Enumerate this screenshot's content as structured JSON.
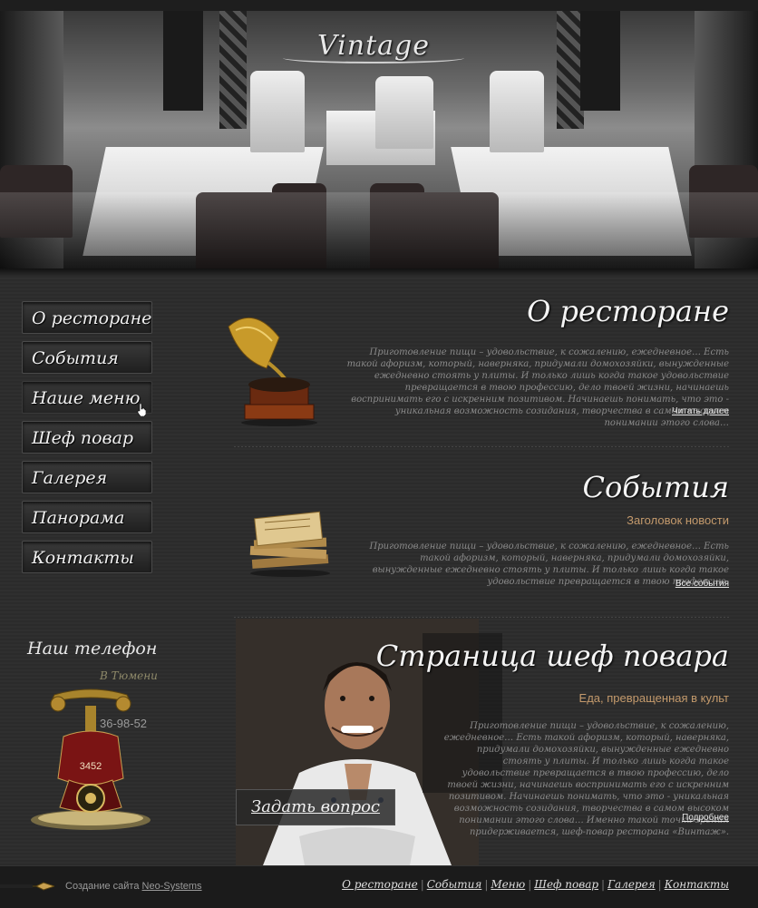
{
  "header": {
    "logo": "Vintage"
  },
  "nav": [
    {
      "label": "О ресторане",
      "id": "about"
    },
    {
      "label": "События",
      "id": "events"
    },
    {
      "label": "Наше меню",
      "id": "menu"
    },
    {
      "label": "Шеф повар",
      "id": "chef"
    },
    {
      "label": "Галерея",
      "id": "gallery"
    },
    {
      "label": "Панорама",
      "id": "panorama"
    },
    {
      "label": "Контакты",
      "id": "contacts"
    }
  ],
  "phone": {
    "title": "Наш телефон",
    "city": "В Тюмени",
    "number_prefix": "3452",
    "number": "36-98-52"
  },
  "about": {
    "title": "О ресторане",
    "text": "Приготовление пищи – удовольствие, к сожалению, ежедневное… Есть такой афоризм, который, наверняка, придумали домохозяйки, вынужденные ежедневно стоять у плиты. И только лишь когда такое удовольствие превращается в твою профессию, дело твоей жизни, начинаешь воспринимать его с искренним позитивом. Начинаешь понимать, что это - уникальная возможность созидания, творчества в самом высоком понимании этого слова…",
    "link": "Читать далее"
  },
  "events": {
    "title": "События",
    "subtitle": "Заголовок новости",
    "text": "Приготовление пищи – удовольствие, к сожалению, ежедневное… Есть такой афоризм, который, наверняка, придумали домохозяйки, вынужденные ежедневно стоять у плиты. И только лишь когда такое удовольствие превращается в твою профессию.",
    "link": "Все события"
  },
  "chef": {
    "title": "Страница шеф повара",
    "subtitle": "Еда, превращенная в культ",
    "text": "Приготовление пищи – удовольствие, к сожалению, ежедневное… Есть такой афоризм, который, наверняка, придумали домохозяйки, вынужденные ежедневно стоять у плиты. И только лишь когда такое удовольствие превращается в твою профессию, дело твоей жизни, начинаешь воспринимать его с искренним позитивом. Начинаешь понимать, что это - уникальная возможность созидания, творчества в самом высоком понимании этого слова… Именно такой точки зрения придерживается, шеф-повар ресторана «Винтаж».",
    "link": "Подробнее",
    "ask_button": "Задать вопрос"
  },
  "footer": {
    "credit_prefix": "Создание сайта",
    "credit_link": "Neo-Systems",
    "links": [
      "О ресторане",
      "События",
      "Меню",
      "Шеф повар",
      "Галерея",
      "Контакты"
    ]
  },
  "colors": {
    "accent": "#c49a6c",
    "background": "#2a2a2a",
    "nav_text": "#f0f0f0"
  }
}
